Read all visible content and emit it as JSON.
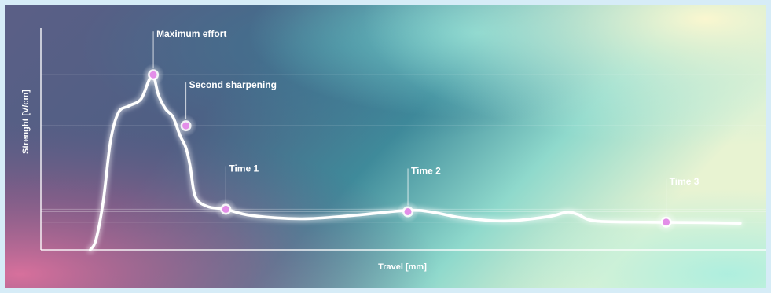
{
  "chart_data": {
    "type": "line",
    "xlabel": "Travel [mm]",
    "ylabel": "Strenght [V/cm]",
    "grid": true,
    "xlim": [
      0,
      100
    ],
    "ylim": [
      0,
      100
    ],
    "series": [
      {
        "x": [
          6.8,
          7.6,
          8.6,
          9.6,
          10.7,
          12.2,
          13.8,
          14.9,
          15.5,
          16.2,
          17.2,
          18.2,
          19.2,
          20.0,
          20.6,
          21.3,
          23.0,
          25.5,
          29.0,
          36.0,
          43.0,
          50.6,
          54.0,
          58.0,
          64.0,
          70.0,
          72.5,
          74.0,
          76.5,
          84.0,
          91.0,
          96.4
        ],
        "values": [
          0.0,
          4.5,
          22.0,
          49.0,
          62.0,
          65.0,
          68.0,
          76.5,
          79.0,
          70.0,
          63.5,
          60.0,
          51.5,
          46.0,
          37.5,
          24.0,
          19.5,
          18.3,
          15.5,
          14.0,
          15.5,
          17.8,
          17.0,
          14.5,
          13.0,
          15.0,
          17.0,
          16.0,
          13.0,
          12.5,
          12.3,
          12.0
        ]
      }
    ],
    "points": [
      {
        "label": "Maximum effort",
        "x": 15.5,
        "y": 79.0
      },
      {
        "label": "Second sharpening",
        "x": 20.0,
        "y": 56.0
      },
      {
        "label": "Time 1",
        "x": 25.5,
        "y": 18.3
      },
      {
        "label": "Time 2",
        "x": 50.6,
        "y": 17.2
      },
      {
        "label": "Time 3",
        "x": 86.2,
        "y": 12.5
      }
    ],
    "colors": {
      "line": "#ffffff",
      "marker": "#e38ee8",
      "axis": "#ffffff"
    }
  }
}
